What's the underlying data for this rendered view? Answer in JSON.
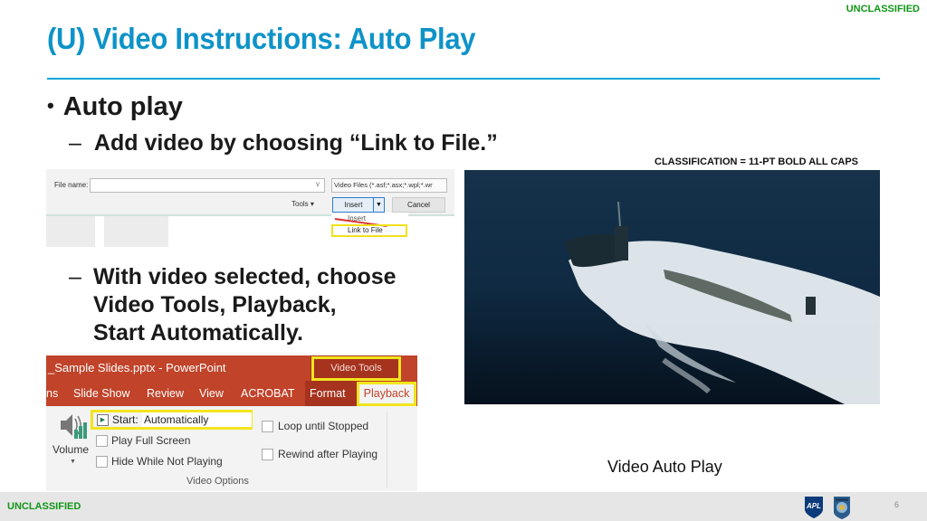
{
  "header": {
    "classification": "UNCLASSIFIED",
    "title": "(U) Video Instructions: Auto Play"
  },
  "body": {
    "bullet1": "Auto play",
    "sub1": "Add video by choosing “Link to File.”",
    "sub2_lines": [
      "With video selected, choose",
      "Video Tools, Playback,",
      "Start Automatically."
    ],
    "dash": "–",
    "dot": "•",
    "classification_note": "CLASSIFICATION = 11-PT BOLD ALL CAPS"
  },
  "file_dialog": {
    "file_name_label": "File name:",
    "file_name_value": "",
    "file_type": "Video Files (*.asf;*.asx;*.wpl;*.wr",
    "tools_label": "Tools",
    "insert_label": "Insert",
    "cancel_label": "Cancel",
    "menu_items": [
      "Insert",
      "Link to File"
    ],
    "highlight_color": "#f2e51e"
  },
  "ppt_ribbon": {
    "window_title": "_Sample Slides.pptx - PowerPoint",
    "context_tab": "Video Tools",
    "tabs": [
      "ns",
      "Slide Show",
      "Review",
      "View",
      "ACROBAT",
      "Format",
      "Playback"
    ],
    "start_label": "Start:",
    "start_value": "Automatically",
    "volume_label": "Volume",
    "checkboxes": [
      {
        "label": "Play Full Screen",
        "checked": false
      },
      {
        "label": "Hide While Not Playing",
        "checked": false
      },
      {
        "label": "Loop until Stopped",
        "checked": false
      },
      {
        "label": "Rewind after Playing",
        "checked": false
      }
    ],
    "group_label": "Video Options",
    "accent_color": "#c0432a"
  },
  "media": {
    "photo_subject": "submarine-surfacing-photo",
    "caption": "Video Auto Play"
  },
  "footer": {
    "classification": "UNCLASSIFIED",
    "logo1": "APL",
    "page_number": "6"
  },
  "colors": {
    "title": "#0e93c8",
    "classification": "#109618",
    "rule": "#14a5d8"
  }
}
